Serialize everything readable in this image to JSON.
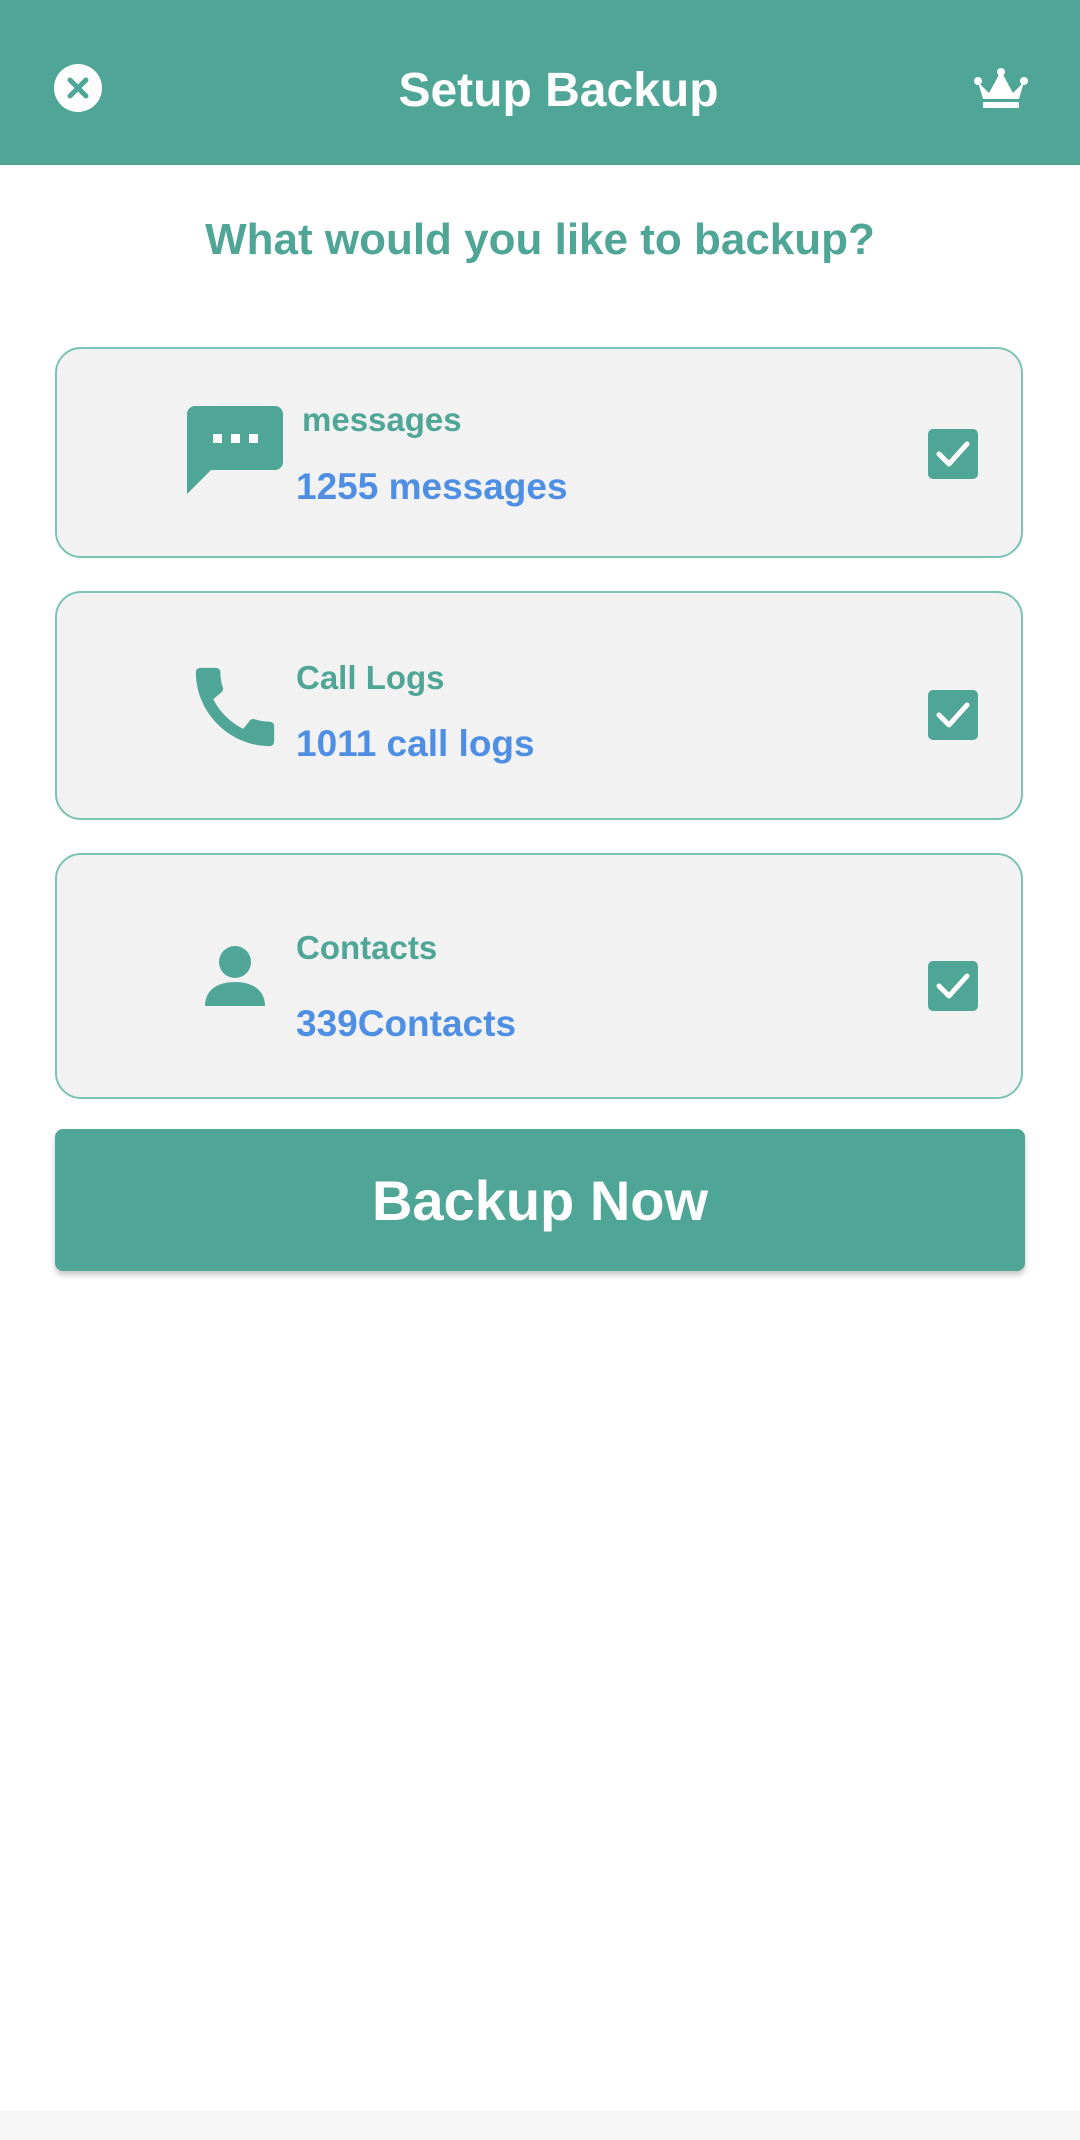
{
  "app_bar": {
    "title": "Setup Backup",
    "close_icon": "close-circle-icon",
    "premium_icon": "crown-icon",
    "color": "#50a696"
  },
  "question": "What would you like to backup?",
  "items": [
    {
      "label": "messages",
      "count": "1255 messages",
      "icon": "chat-bubble-icon",
      "checked": true
    },
    {
      "label": "Call Logs",
      "count": "1011 call logs",
      "icon": "phone-icon",
      "checked": true
    },
    {
      "label": "Contacts",
      "count": "339Contacts",
      "icon": "person-icon",
      "checked": true
    }
  ],
  "backup_button": {
    "label": "Backup Now"
  },
  "colors": {
    "accent": "#50a696",
    "count_text": "#4f8fe3",
    "card_background": "#f2f2f2"
  }
}
